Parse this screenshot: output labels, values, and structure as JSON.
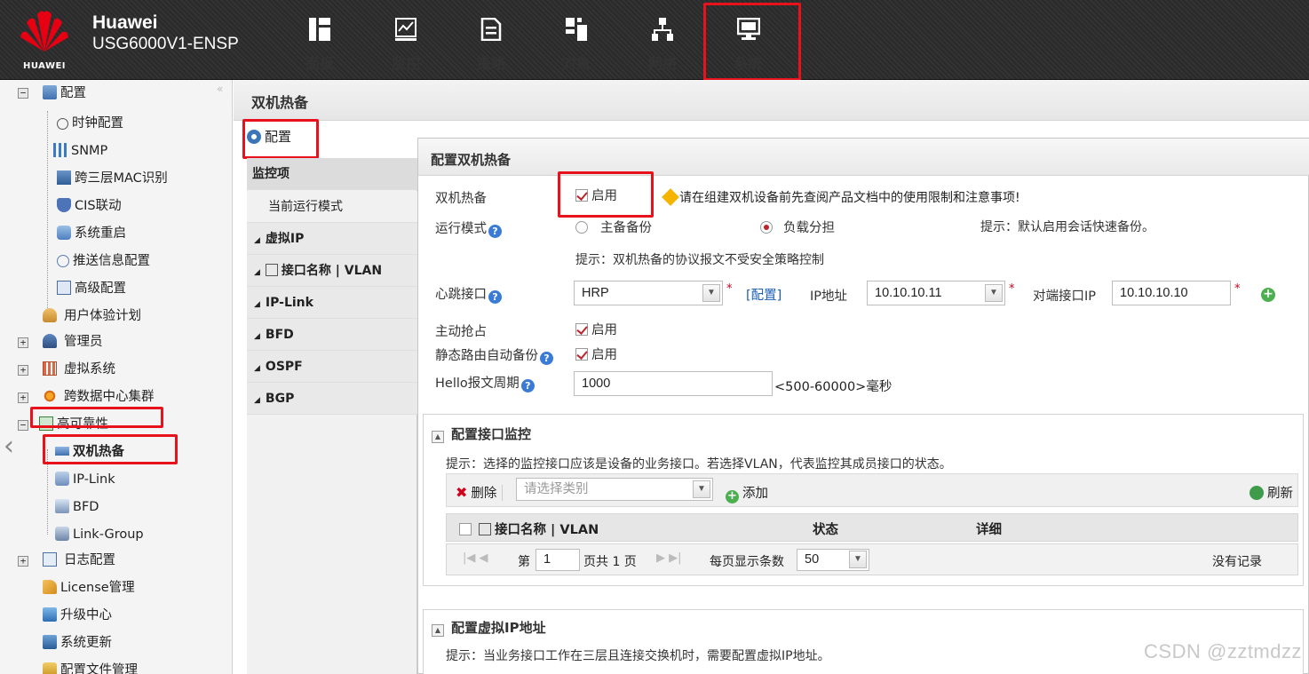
{
  "header": {
    "logo_text": "HUAWEI",
    "brand_line1": "Huawei",
    "brand_line2": "USG6000V1-ENSP",
    "nav": [
      {
        "label": "面板",
        "icon": "dashboard-icon"
      },
      {
        "label": "监控",
        "icon": "monitor-chart-icon"
      },
      {
        "label": "策略",
        "icon": "policy-document-icon"
      },
      {
        "label": "对象",
        "icon": "object-icon"
      },
      {
        "label": "网络",
        "icon": "network-icon"
      },
      {
        "label": "系统",
        "icon": "system-display-icon"
      }
    ]
  },
  "sidebar": {
    "items": [
      {
        "label": "配置",
        "icon": "config-icon"
      },
      {
        "label": "时钟配置",
        "icon": "clock-icon"
      },
      {
        "label": "SNMP",
        "icon": "snmp-icon"
      },
      {
        "label": "跨三层MAC识别",
        "icon": "mac-icon"
      },
      {
        "label": "CIS联动",
        "icon": "cis-shield-icon"
      },
      {
        "label": "系统重启",
        "icon": "restart-icon"
      },
      {
        "label": "推送信息配置",
        "icon": "push-message-icon"
      },
      {
        "label": "高级配置",
        "icon": "advanced-config-icon"
      },
      {
        "label": "用户体验计划",
        "icon": "user-experience-icon"
      },
      {
        "label": "管理员",
        "icon": "admin-icon"
      },
      {
        "label": "虚拟系统",
        "icon": "virtual-system-icon"
      },
      {
        "label": "跨数据中心集群",
        "icon": "cluster-icon"
      },
      {
        "label": "高可靠性",
        "icon": "high-availability-icon"
      },
      {
        "label": "双机热备",
        "icon": "hot-standby-icon"
      },
      {
        "label": "IP-Link",
        "icon": "ip-link-icon"
      },
      {
        "label": "BFD",
        "icon": "bfd-icon"
      },
      {
        "label": "Link-Group",
        "icon": "link-group-icon"
      },
      {
        "label": "日志配置",
        "icon": "log-config-icon"
      },
      {
        "label": "License管理",
        "icon": "license-icon"
      },
      {
        "label": "升级中心",
        "icon": "upgrade-icon"
      },
      {
        "label": "系统更新",
        "icon": "system-update-icon"
      },
      {
        "label": "配置文件管理",
        "icon": "config-file-icon"
      }
    ]
  },
  "page_title": "双机热备",
  "config_tab": "配置",
  "monitor": {
    "header": "监控项",
    "current_mode": "当前运行模式",
    "groups": [
      "虚拟IP",
      "接口名称 | VLAN",
      "IP-Link",
      "BFD",
      "OSPF",
      "BGP"
    ]
  },
  "panel": {
    "title": "配置双机热备",
    "hot_standby_label": "双机热备",
    "enable_label": "启用",
    "warning": "请在组建双机设备前先查阅产品文档中的使用限制和注意事项!",
    "mode_label": "运行模式",
    "mode_options": [
      "主备备份",
      "负载分担"
    ],
    "mode_hint": "提示：默认启用会话快速备份。",
    "protocol_hint": "提示：双机热备的协议报文不受安全策略控制",
    "heartbeat_label": "心跳接口",
    "heartbeat_value": "HRP",
    "config_link": "[配置]",
    "ip_label": "IP地址",
    "ip_value": "10.10.10.11",
    "peer_label": "对端接口IP",
    "peer_value": "10.10.10.10",
    "preempt_label": "主动抢占",
    "static_route_label": "静态路由自动备份",
    "hello_label": "Hello报文周期",
    "hello_value": "1000",
    "hello_range": "<500-60000>毫秒",
    "required_mark": "*",
    "help_glyph": "?"
  },
  "iface_monitor": {
    "title": "配置接口监控",
    "hint": "提示：选择的监控接口应该是设备的业务接口。若选择VLAN，代表监控其成员接口的状态。",
    "delete_label": "删除",
    "category_placeholder": "请选择类别",
    "add_label": "添加",
    "refresh_label": "刷新",
    "columns": [
      "接口名称 | VLAN",
      "状态",
      "详细"
    ],
    "pager": {
      "page_prefix": "第",
      "page_value": "1",
      "page_suffix": "页共 1 页",
      "per_page_label": "每页显示条数",
      "per_page_value": "50",
      "no_records": "没有记录"
    }
  },
  "virtual_ip": {
    "title": "配置虚拟IP地址",
    "hint": "提示：当业务接口工作在三层且连接交换机时，需要配置虚拟IP地址。"
  },
  "watermark": "CSDN @zztmdzz",
  "colors": {
    "highlight": "#e8121c",
    "accent": "#c0242b",
    "link": "#1a5fb4"
  }
}
